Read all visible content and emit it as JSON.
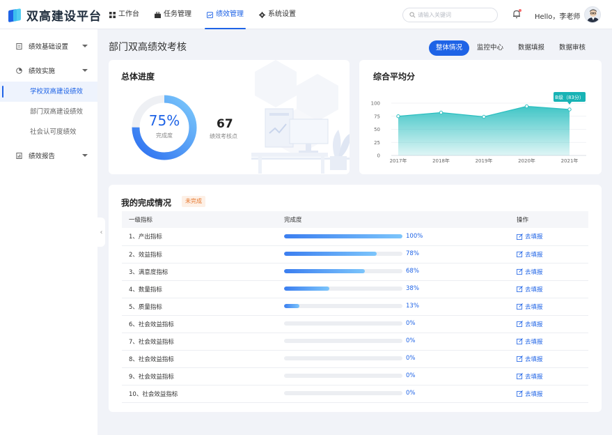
{
  "app": {
    "title": "双高建设平台"
  },
  "nav": {
    "items": [
      {
        "label": "工作台",
        "icon": "grid-icon"
      },
      {
        "label": "任务管理",
        "icon": "briefcase-icon"
      },
      {
        "label": "绩效管理",
        "icon": "chart-box-icon",
        "active": true
      },
      {
        "label": "系统设置",
        "icon": "gear-icon"
      }
    ]
  },
  "search": {
    "placeholder": "请输入关键词"
  },
  "user": {
    "greeting": "Hello，李老师"
  },
  "sidebar": {
    "group1": "绩效基础设置",
    "group2": "绩效实施",
    "subs": [
      "学校双高建设绩效",
      "部门双高建设绩效",
      "社会认可度绩效"
    ],
    "group3": "绩效报告"
  },
  "page": {
    "title": "部门双高绩效考核"
  },
  "tabs": [
    "整体情况",
    "监控中心",
    "数据填报",
    "数据审核"
  ],
  "progress": {
    "title": "总体进度",
    "percent_text": "75%",
    "percent": 75,
    "percent_label": "完成度",
    "points": "67",
    "points_label": "绩效考核点"
  },
  "avg": {
    "title": "综合平均分",
    "tooltip": "B级（83分）"
  },
  "chart_data": {
    "type": "area",
    "x": [
      "2017年",
      "2018年",
      "2019年",
      "2020年",
      "2021年"
    ],
    "values": [
      75,
      82,
      74,
      94,
      88
    ],
    "ylim": [
      0,
      100
    ],
    "yticks": [
      0,
      25,
      50,
      75,
      100
    ],
    "grid": true,
    "color": "#2bbfc0"
  },
  "completion": {
    "title": "我的完成情况",
    "status": "未完成",
    "headers": [
      "一级指标",
      "完成度",
      "操作"
    ],
    "rows": [
      {
        "name": "1、产出指标",
        "pct": 100,
        "pct_text": "100%",
        "action": "去填报"
      },
      {
        "name": "2、效益指标",
        "pct": 78,
        "pct_text": "78%",
        "action": "去填报"
      },
      {
        "name": "3、满意度指标",
        "pct": 68,
        "pct_text": "68%",
        "action": "去填报"
      },
      {
        "name": "4、数量指标",
        "pct": 38,
        "pct_text": "38%",
        "action": "去填报"
      },
      {
        "name": "5、质量指标",
        "pct": 13,
        "pct_text": "13%",
        "action": "去填报"
      },
      {
        "name": "6、社会效益指标",
        "pct": 0,
        "pct_text": "0%",
        "action": "去填报"
      },
      {
        "name": "7、社会效益指标",
        "pct": 0,
        "pct_text": "0%",
        "action": "去填报"
      },
      {
        "name": "8、社会效益指标",
        "pct": 0,
        "pct_text": "0%",
        "action": "去填报"
      },
      {
        "name": "9、社会效益指标",
        "pct": 0,
        "pct_text": "0%",
        "action": "去填报"
      },
      {
        "name": "10、社会效益指标",
        "pct": 0,
        "pct_text": "0%",
        "action": "去填报"
      }
    ]
  },
  "colors": {
    "accent": "#1e63e6",
    "teal": "#2bbfc0",
    "warning": "#e6772e"
  }
}
